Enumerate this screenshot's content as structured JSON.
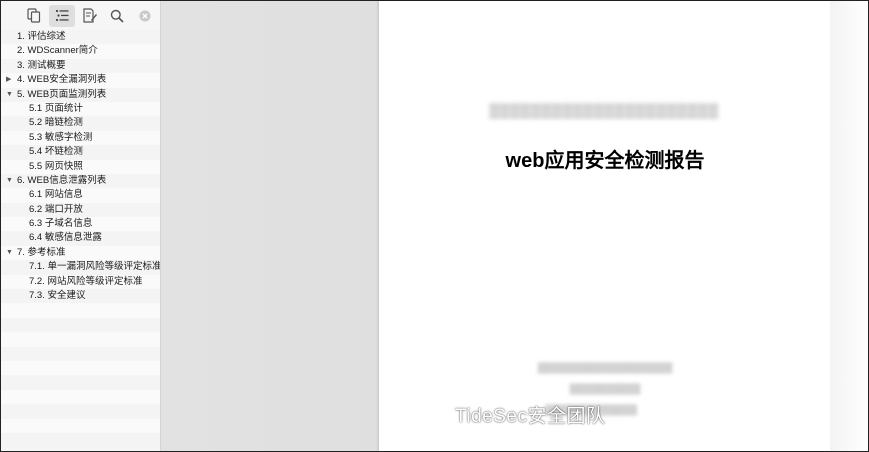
{
  "toolbar": {
    "icons": [
      "thumbnails-icon",
      "outline-icon",
      "annotations-icon",
      "search-icon",
      "close-icon"
    ]
  },
  "outline": [
    {
      "label": "1. 评估综述",
      "level": 1,
      "toggle": ""
    },
    {
      "label": "2. WDScanner简介",
      "level": 1,
      "toggle": ""
    },
    {
      "label": "3. 测试概要",
      "level": 1,
      "toggle": ""
    },
    {
      "label": "4. WEB安全漏洞列表",
      "level": 1,
      "toggle": "▶"
    },
    {
      "label": "5. WEB页面监测列表",
      "level": 1,
      "toggle": "▼"
    },
    {
      "label": "5.1 页面统计",
      "level": 2,
      "toggle": ""
    },
    {
      "label": "5.2 暗链检测",
      "level": 2,
      "toggle": ""
    },
    {
      "label": "5.3 敏感字检测",
      "level": 2,
      "toggle": ""
    },
    {
      "label": "5.4 坏链检测",
      "level": 2,
      "toggle": ""
    },
    {
      "label": "5.5 网页快照",
      "level": 2,
      "toggle": ""
    },
    {
      "label": "6. WEB信息泄露列表",
      "level": 1,
      "toggle": "▼"
    },
    {
      "label": "6.1 网站信息",
      "level": 2,
      "toggle": ""
    },
    {
      "label": "6.2 端口开放",
      "level": 2,
      "toggle": ""
    },
    {
      "label": "6.3 子域名信息",
      "level": 2,
      "toggle": ""
    },
    {
      "label": "6.4 敏感信息泄露",
      "level": 2,
      "toggle": ""
    },
    {
      "label": "7. 参考标准",
      "level": 1,
      "toggle": "▼"
    },
    {
      "label": "7.1. 单一漏洞风险等级评定标准",
      "level": 2,
      "toggle": ""
    },
    {
      "label": "7.2. 网站风险等级评定标准",
      "level": 2,
      "toggle": ""
    },
    {
      "label": "7.3. 安全建议",
      "level": 2,
      "toggle": ""
    }
  ],
  "document": {
    "title": "web应用安全检测报告"
  },
  "watermark": {
    "text": "TideSec安全团队"
  }
}
